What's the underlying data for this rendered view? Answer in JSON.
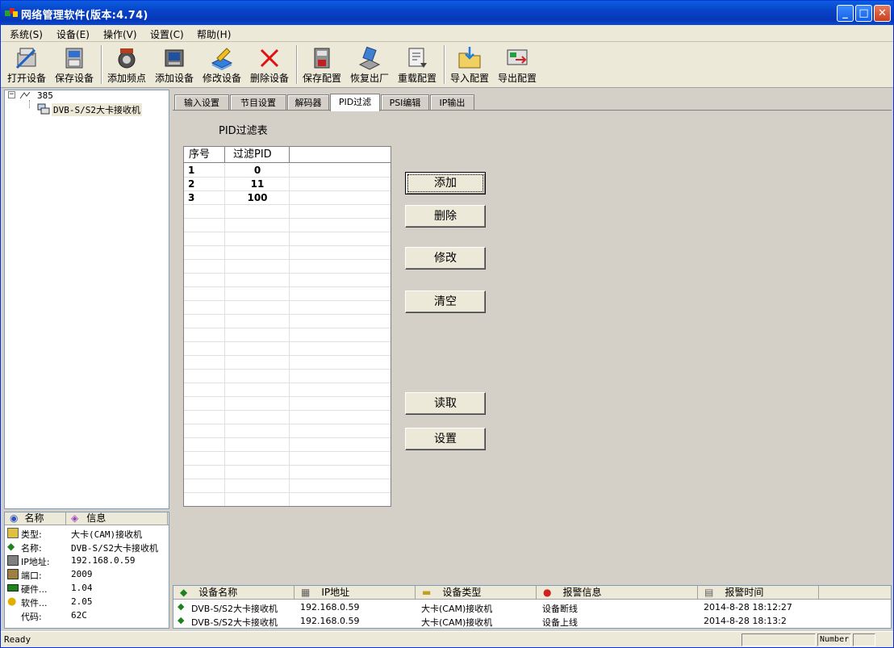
{
  "window": {
    "title": "网络管理软件(版本:4.74)"
  },
  "menu": [
    "系统(S)",
    "设备(E)",
    "操作(V)",
    "设置(C)",
    "帮助(H)"
  ],
  "toolbar": [
    "打开设备",
    "保存设备",
    "添加频点",
    "添加设备",
    "修改设备",
    "删除设备",
    "保存配置",
    "恢复出厂",
    "重载配置",
    "导入配置",
    "导出配置"
  ],
  "tree": {
    "root": "385",
    "child": "DVB-S/S2大卡接收机"
  },
  "info": {
    "headers": [
      "名称",
      "信息"
    ],
    "rows": [
      {
        "key": "类型:",
        "value": "大卡(CAM)接收机"
      },
      {
        "key": "名称:",
        "value": "DVB-S/S2大卡接收机"
      },
      {
        "key": "IP地址:",
        "value": "192.168.0.59"
      },
      {
        "key": "端口:",
        "value": "2009"
      },
      {
        "key": "硬件...",
        "value": "1.04"
      },
      {
        "key": "软件...",
        "value": "2.05"
      },
      {
        "key": "代码:",
        "value": "62C"
      }
    ]
  },
  "tabs": [
    "输入设置",
    "节目设置",
    "解码器",
    "PID过滤",
    "PSI编辑",
    "IP输出"
  ],
  "active_tab": 3,
  "pid": {
    "title": "PID过滤表",
    "columns": [
      "序号",
      "过滤PID"
    ],
    "rows": [
      {
        "index": "1",
        "pid": "0"
      },
      {
        "index": "2",
        "pid": "11"
      },
      {
        "index": "3",
        "pid": "100"
      }
    ]
  },
  "buttons": {
    "add": "添加",
    "delete": "删除",
    "modify": "修改",
    "clear": "清空",
    "read": "读取",
    "set": "设置"
  },
  "alarm": {
    "headers": [
      "设备名称",
      "IP地址",
      "设备类型",
      "报警信息",
      "报警时间"
    ],
    "rows": [
      {
        "name": "DVB-S/S2大卡接收机",
        "ip": "192.168.0.59",
        "type": "大卡(CAM)接收机",
        "msg": "设备断线",
        "time": "2014-8-28 18:12:27"
      },
      {
        "name": "DVB-S/S2大卡接收机",
        "ip": "192.168.0.59",
        "type": "大卡(CAM)接收机",
        "msg": "设备上线",
        "time": "2014-8-28 18:13:2"
      }
    ]
  },
  "status": {
    "text": "Ready",
    "number": "Number"
  }
}
